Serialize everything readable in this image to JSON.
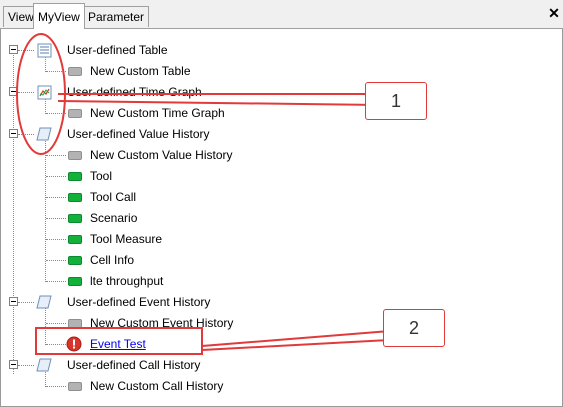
{
  "tabs": [
    {
      "label": "View",
      "active": false
    },
    {
      "label": "MyView",
      "active": true
    },
    {
      "label": "Parameter",
      "active": false
    }
  ],
  "close_glyph": "✕",
  "tree": [
    {
      "label": "User-defined Table",
      "icon": "table-icon"
    },
    {
      "label": "New Custom Table",
      "icon": "gray-item-icon"
    },
    {
      "label": "User-defined Time Graph",
      "icon": "time-graph-icon"
    },
    {
      "label": "New Custom Time Graph",
      "icon": "gray-item-icon"
    },
    {
      "label": "User-defined Value History",
      "icon": "history-scroll-icon"
    },
    {
      "label": "New Custom Value History",
      "icon": "gray-item-icon"
    },
    {
      "label": "Tool",
      "icon": "green-item-icon"
    },
    {
      "label": "Tool Call",
      "icon": "green-item-icon"
    },
    {
      "label": "Scenario",
      "icon": "green-item-icon"
    },
    {
      "label": "Tool Measure",
      "icon": "green-item-icon"
    },
    {
      "label": "Cell Info",
      "icon": "green-item-icon"
    },
    {
      "label": "lte throughput",
      "icon": "green-item-icon"
    },
    {
      "label": "User-defined Event History",
      "icon": "history-scroll-icon"
    },
    {
      "label": "New Custom Event History",
      "icon": "gray-item-icon"
    },
    {
      "label": "Event Test",
      "icon": "alert-icon"
    },
    {
      "label": "User-defined Call History",
      "icon": "history-scroll-icon"
    },
    {
      "label": "New Custom Call History",
      "icon": "gray-item-icon"
    }
  ],
  "annotations": {
    "callout_1": "1",
    "callout_2": "2"
  },
  "colors": {
    "annotation": "#e03a3a",
    "link": "#0000ee",
    "green": "#13b13b"
  }
}
